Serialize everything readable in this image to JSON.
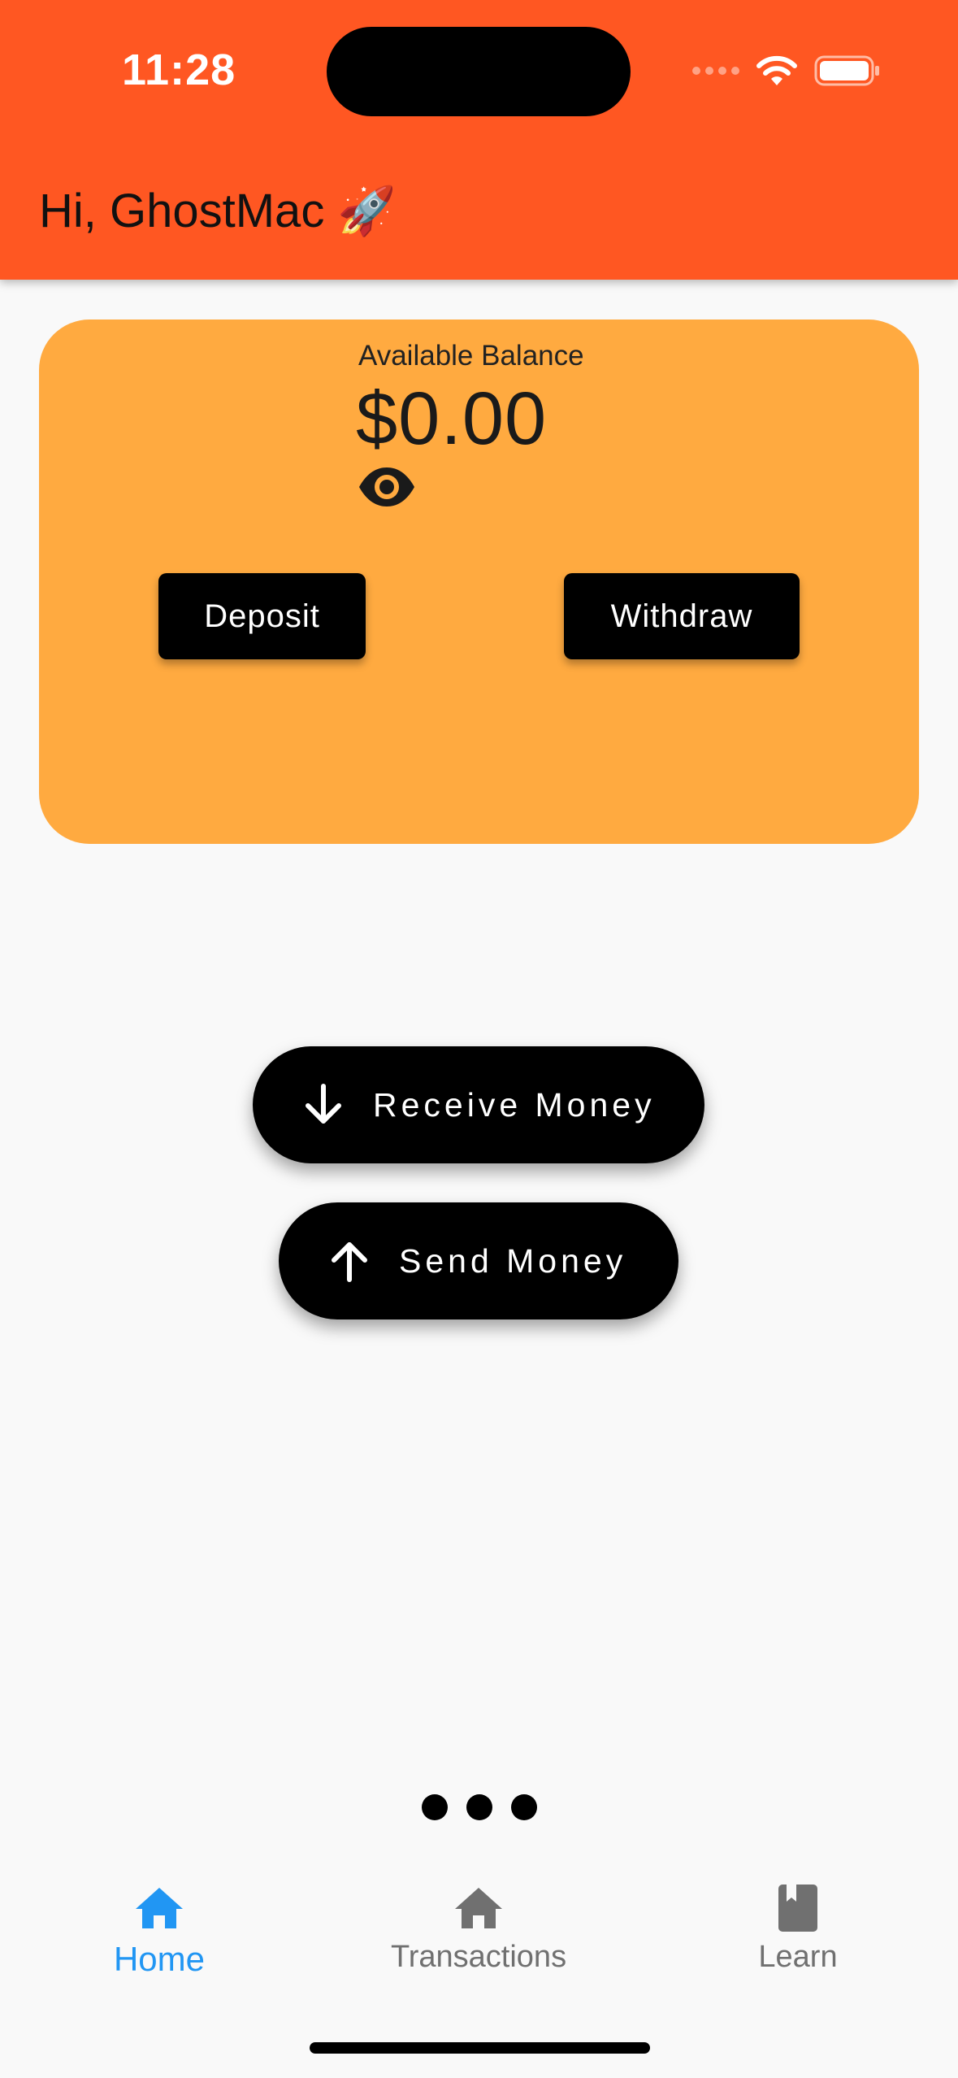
{
  "status_bar": {
    "time": "11:28"
  },
  "header": {
    "greeting": "Hi, GhostMac 🚀",
    "background_color": "#ff5722"
  },
  "balance_card": {
    "label": "Available Balance",
    "amount": "$0.00",
    "visibility_icon": "eye-icon",
    "background_color": "#ffaa40",
    "deposit_label": "Deposit",
    "withdraw_label": "Withdraw"
  },
  "actions": {
    "receive_label": "Receive Money",
    "receive_icon": "arrow-down-icon",
    "send_label": "Send Money",
    "send_icon": "arrow-up-icon"
  },
  "page_indicator": {
    "count": 3
  },
  "bottom_nav": {
    "items": [
      {
        "label": "Home",
        "icon": "home-icon",
        "active": true
      },
      {
        "label": "Transactions",
        "icon": "home-icon",
        "active": false
      },
      {
        "label": "Learn",
        "icon": "book-icon",
        "active": false
      }
    ],
    "active_color": "#2196f3",
    "inactive_color": "#707070"
  }
}
